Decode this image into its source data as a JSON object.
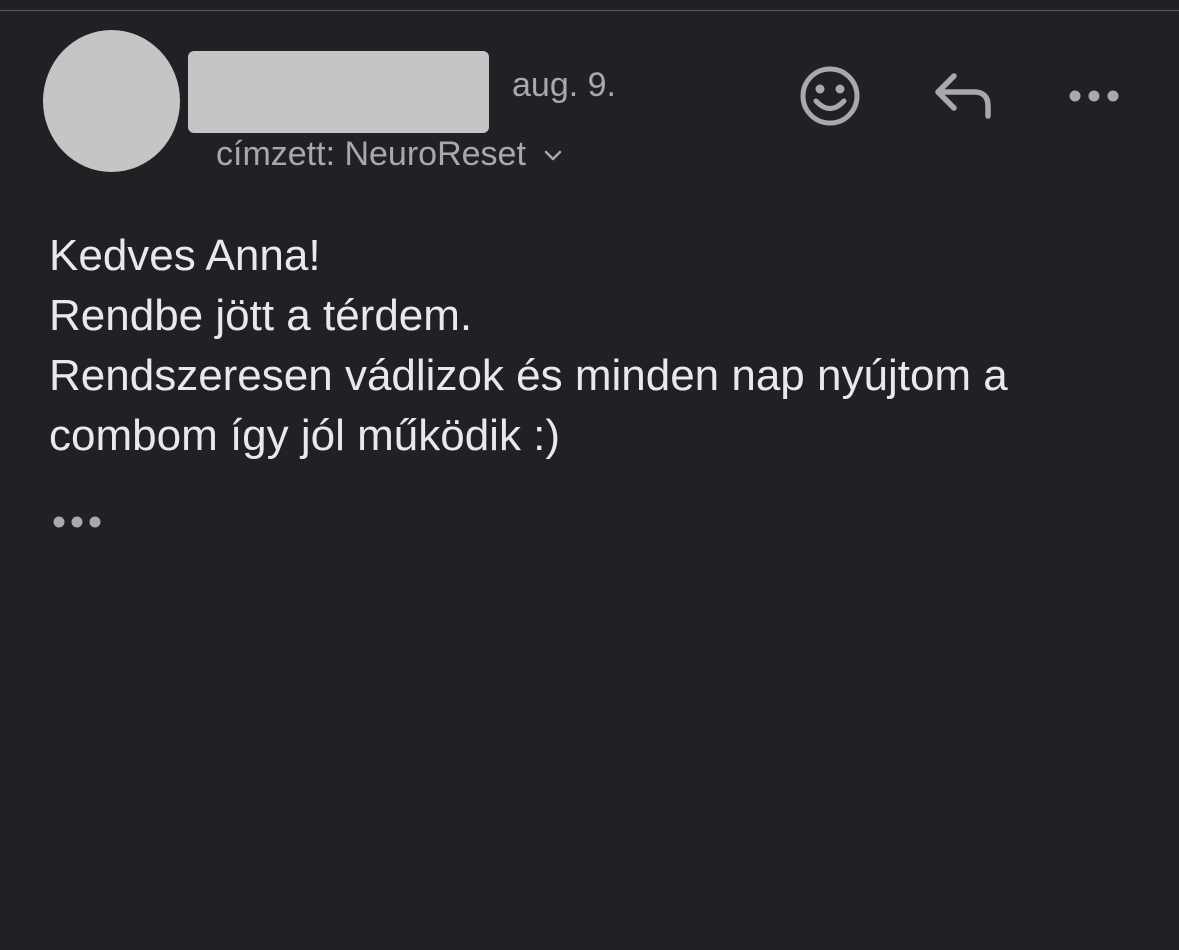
{
  "message": {
    "date": "aug. 9.",
    "recipient": "címzett: NeuroReset",
    "body_lines": [
      "Kedves Anna!",
      "Rendbe jött a térdem.",
      "Rendszeresen vádlizok és minden nap nyújtom a",
      "combom így jól működik :)"
    ]
  },
  "icons": {
    "expand": "chevron-down-icon",
    "react": "smiley-icon",
    "reply": "reply-arrow-icon",
    "more": "more-dots-icon",
    "show_trimmed": "ellipsis-icon"
  },
  "colors": {
    "background": "#202124",
    "body_text": "#e8e9eb",
    "secondary_text": "#a8a9ad",
    "redaction": "#c5c5c5"
  }
}
